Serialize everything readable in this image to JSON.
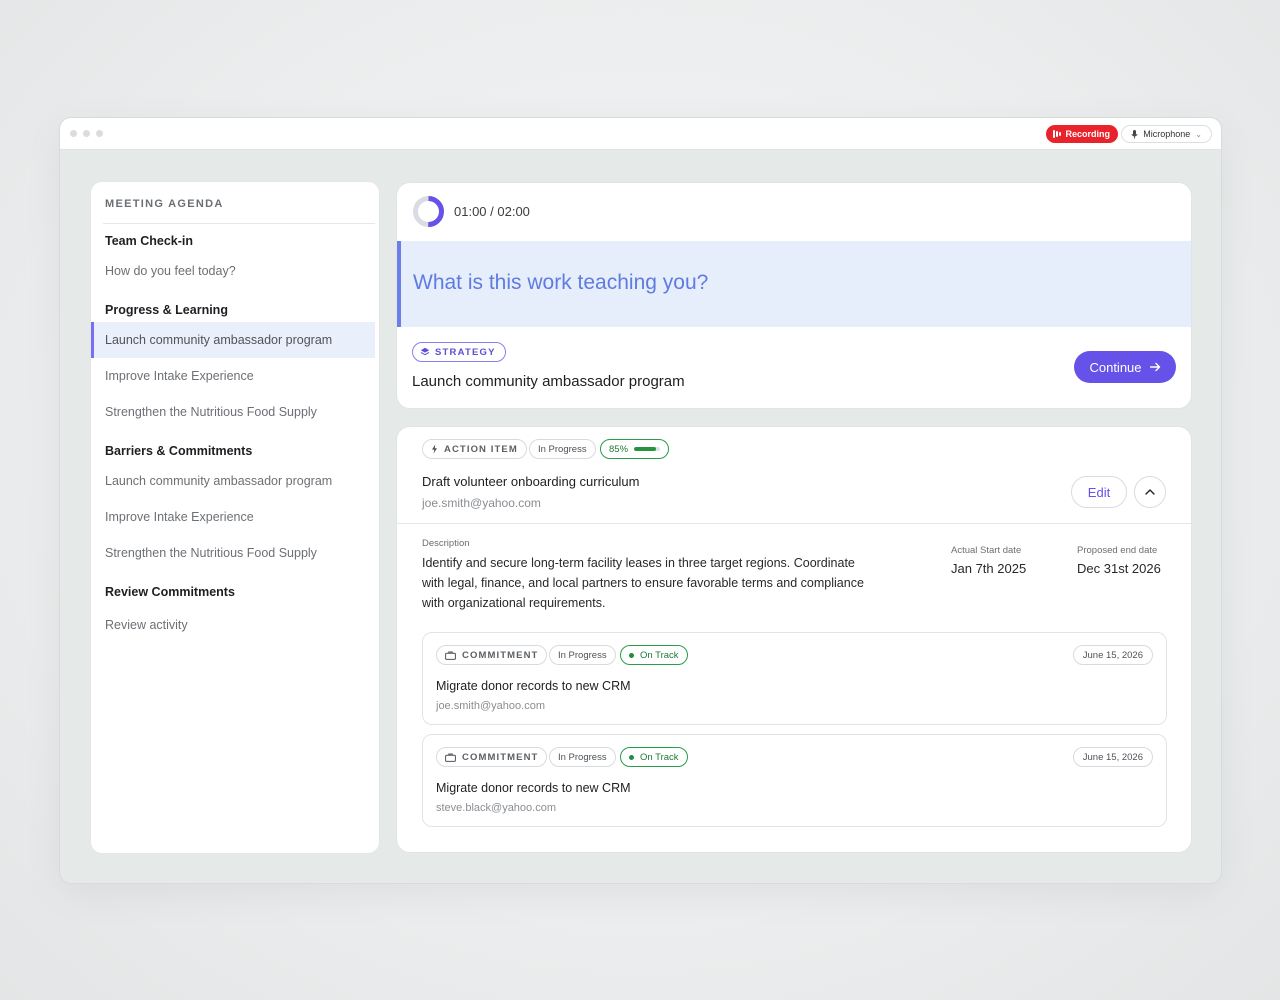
{
  "titlebar": {
    "recording_label": "Recording",
    "microphone_label": "Microphone"
  },
  "sidebar": {
    "title": "MEETING AGENDA",
    "sections": [
      {
        "label": "Team Check-in",
        "items": [
          "How do you feel today?"
        ]
      },
      {
        "label": "Progress & Learning",
        "items": [
          "Launch community ambassador program",
          "Improve Intake Experience",
          "Strengthen the Nutritious Food Supply"
        ]
      },
      {
        "label": "Barriers & Commitments",
        "items": [
          "Launch community ambassador program",
          "Improve Intake Experience",
          "Strengthen the Nutritious Food Supply"
        ]
      },
      {
        "label": "Review Commitments",
        "items": [
          "Review activity"
        ]
      }
    ],
    "active_item": "Launch community ambassador program"
  },
  "prompt_card": {
    "timer": "01:00 / 02:00",
    "timer_progress": 0.5,
    "question": "What is this work teaching you?",
    "tag": "STRATEGY",
    "strategy_title": "Launch community ambassador program",
    "continue_label": "Continue"
  },
  "action_item": {
    "type_label": "ACTION ITEM",
    "status": "In Progress",
    "progress_label": "85%",
    "progress": 0.85,
    "title": "Draft volunteer onboarding curriculum",
    "email": "joe.smith@yahoo.com",
    "edit_label": "Edit",
    "description_label": "Description",
    "description": "Identify and secure long-term facility leases in three target regions. Coordinate with legal, finance, and local partners to ensure favorable terms and compliance with organizational requirements.",
    "start_label": "Actual Start date",
    "start_value": "Jan 7th 2025",
    "end_label": "Proposed end date",
    "end_value": "Dec 31st 2026"
  },
  "commitments": [
    {
      "type_label": "COMMITMENT",
      "status": "In Progress",
      "track": "On Track",
      "date": "June 15, 2026",
      "title": "Migrate donor records to new CRM",
      "email": "joe.smith@yahoo.com"
    },
    {
      "type_label": "COMMITMENT",
      "status": "In Progress",
      "track": "On Track",
      "date": "June 15, 2026",
      "title": "Migrate donor records to new CRM",
      "email": "steve.black@yahoo.com"
    }
  ],
  "colors": {
    "accent": "#6652e8",
    "recording": "#e8232b",
    "prompt_bg": "#e6eefc",
    "on_track": "#1f8e3e"
  }
}
